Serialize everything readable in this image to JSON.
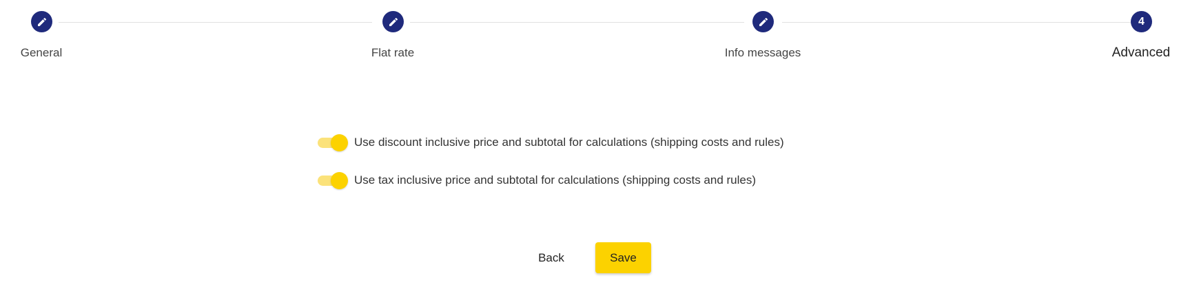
{
  "stepper": {
    "steps": [
      {
        "label": "General",
        "state": "edit",
        "icon": "pencil-icon"
      },
      {
        "label": "Flat rate",
        "state": "edit",
        "icon": "pencil-icon"
      },
      {
        "label": "Info messages",
        "state": "edit",
        "icon": "pencil-icon"
      },
      {
        "label": "Advanced",
        "state": "active",
        "number": "4"
      }
    ]
  },
  "options": [
    {
      "label": "Use discount inclusive price and subtotal for calculations (shipping costs and rules)",
      "checked": true
    },
    {
      "label": "Use tax inclusive price and subtotal for calculations (shipping costs and rules)",
      "checked": true
    }
  ],
  "actions": {
    "back_label": "Back",
    "save_label": "Save"
  },
  "colors": {
    "step_circle": "#1f2a7c",
    "toggle_thumb": "#fcd200",
    "toggle_track": "#fbe27a",
    "save_button": "#fcd200"
  }
}
